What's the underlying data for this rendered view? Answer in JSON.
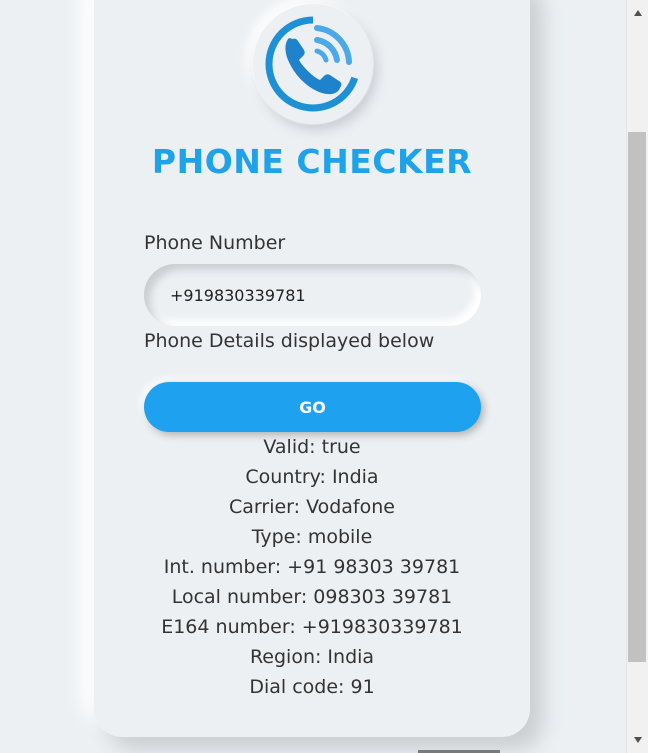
{
  "app": {
    "title": "PHONE CHECKER",
    "logo_icon": "phone-call-icon",
    "accent_color": "#1ea2e9"
  },
  "form": {
    "phone_label": "Phone Number",
    "phone_value": "+919830339781",
    "details_label": "Phone Details displayed below",
    "go_label": "GO"
  },
  "results": [
    "Valid: true",
    "Country: India",
    "Carrier: Vodafone",
    "Type: mobile",
    "Int. number: +91 98303 39781",
    "Local number: 098303 39781",
    "E164 number: +919830339781",
    "Region: India",
    "Dial code: 91"
  ],
  "scrollbar": {
    "up_icon": "triangle-up-icon",
    "down_icon": "triangle-down-icon"
  }
}
